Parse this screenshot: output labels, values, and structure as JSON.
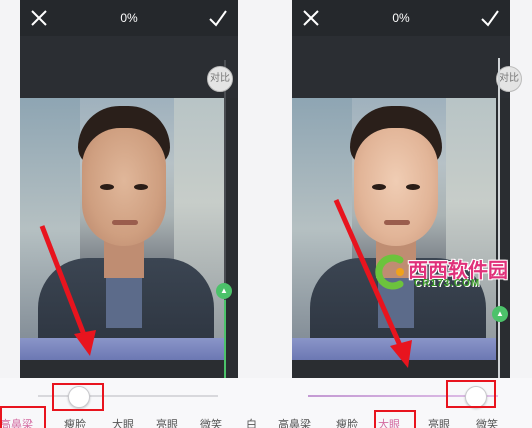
{
  "panels": [
    {
      "header": {
        "progress_label": "0%",
        "close_icon": "close-icon",
        "confirm_icon": "check-icon"
      },
      "compare_label": "对比",
      "slider_value": 0.22,
      "tabs": [
        {
          "label": "高鼻梁"
        },
        {
          "label": "瘦脸"
        },
        {
          "label": "大眼"
        },
        {
          "label": "亮眼"
        },
        {
          "label": "微笑"
        },
        {
          "label": "白"
        }
      ]
    },
    {
      "header": {
        "progress_label": "0%",
        "close_icon": "close-icon",
        "confirm_icon": "check-icon"
      },
      "compare_label": "对比",
      "slider_value": 0.88,
      "tabs": [
        {
          "label": "高鼻梁"
        },
        {
          "label": "瘦脸"
        },
        {
          "label": "大眼"
        },
        {
          "label": "亮眼"
        },
        {
          "label": "微笑"
        }
      ]
    }
  ],
  "watermark": {
    "title": "西西软件园",
    "subtitle": "CR173.COM"
  },
  "colors": {
    "highlight": "#e8141e",
    "accent_active": "#d36aa0",
    "confirm_green": "#4cc26a",
    "app_dark": "#2a2d31"
  }
}
